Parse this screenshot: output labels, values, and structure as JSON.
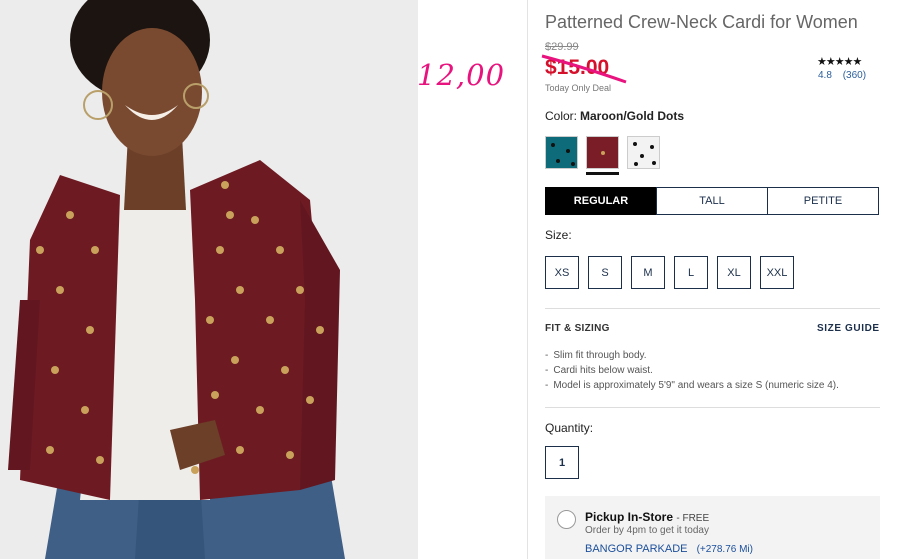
{
  "annotation": "12,00",
  "product": {
    "title": "Patterned Crew-Neck Cardi for Women",
    "original_price": "$29.99",
    "sale_price": "$15.00",
    "deal_label": "Today Only Deal",
    "stars": "★★★★★",
    "rating": "4.8",
    "review_count": "(360)"
  },
  "color": {
    "label": "Color:",
    "selected": "Maroon/Gold Dots",
    "swatches": [
      {
        "name": "teal",
        "hex": "#0e6c7a"
      },
      {
        "name": "maroon",
        "hex": "#7a1d26"
      },
      {
        "name": "white",
        "hex": "#f3f3f3"
      }
    ]
  },
  "fit": {
    "options": [
      "REGULAR",
      "TALL",
      "PETITE"
    ],
    "selected": "REGULAR"
  },
  "size": {
    "label": "Size:",
    "options": [
      "XS",
      "S",
      "M",
      "L",
      "XL",
      "XXL"
    ]
  },
  "fit_sizing": {
    "title": "FIT & SIZING",
    "guide_link": "SIZE GUIDE",
    "bullets": [
      "Slim fit through body.",
      "Cardi hits below waist.",
      "Model is approximately 5'9\" and wears a size S (numeric size 4)."
    ]
  },
  "quantity": {
    "label": "Quantity:",
    "value": "1"
  },
  "pickup": {
    "title": "Pickup In-Store",
    "free": "- FREE",
    "subtitle": "Order by 4pm to get it today",
    "store": "BANGOR PARKADE",
    "distance": "(+278.76 Mi)"
  },
  "colors": {
    "sale_red": "#d5102b",
    "annotation_pink": "#e8137e",
    "navy": "#1b2f4b",
    "link_blue": "#1b4f9b",
    "sweater_maroon": "#6e1a22",
    "polka_gold": "#c9a15a"
  }
}
